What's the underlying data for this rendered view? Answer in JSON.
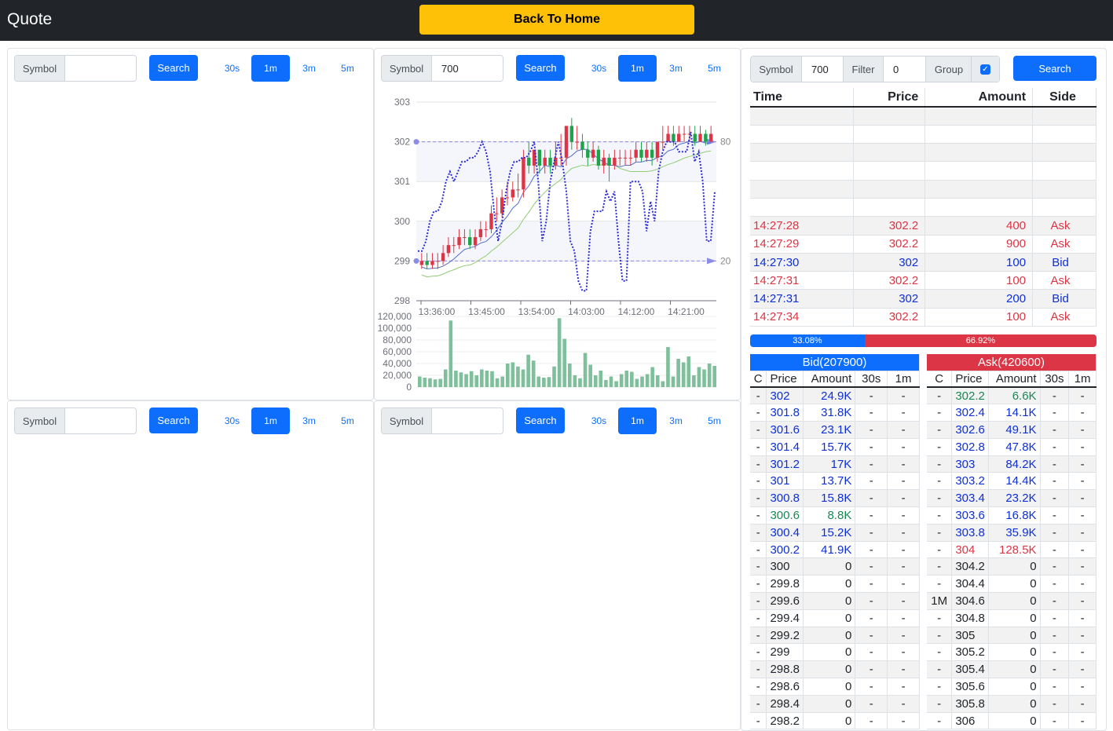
{
  "header": {
    "brand": "Quote",
    "home_button": "Back To Home"
  },
  "panels": [
    {
      "symbol_label": "Symbol",
      "symbol_value": "",
      "search": "Search",
      "intervals": [
        "30s",
        "1m",
        "3m",
        "5m"
      ],
      "active": "1m"
    },
    {
      "symbol_label": "Symbol",
      "symbol_value": "700",
      "search": "Search",
      "intervals": [
        "30s",
        "1m",
        "3m",
        "5m"
      ],
      "active": "1m"
    },
    {
      "symbol_label": "Symbol",
      "symbol_value": "",
      "search": "Search",
      "intervals": [
        "30s",
        "1m",
        "3m",
        "5m"
      ],
      "active": "1m"
    },
    {
      "symbol_label": "Symbol",
      "symbol_value": "",
      "search": "Search",
      "intervals": [
        "30s",
        "1m",
        "3m",
        "5m"
      ],
      "active": "1m"
    }
  ],
  "trade_panel": {
    "symbol_label": "Symbol",
    "symbol_value": "700",
    "filter_label": "Filter",
    "filter_value": "0",
    "group_label": "Group",
    "group_checked": true,
    "search": "Search",
    "columns": [
      "Time",
      "Price",
      "Amount",
      "Side"
    ],
    "rows": [
      {
        "time": "",
        "price": "",
        "amount": "",
        "side": ""
      },
      {
        "time": "",
        "price": "",
        "amount": "",
        "side": ""
      },
      {
        "time": "",
        "price": "",
        "amount": "",
        "side": ""
      },
      {
        "time": "",
        "price": "",
        "amount": "",
        "side": ""
      },
      {
        "time": "",
        "price": "",
        "amount": "",
        "side": ""
      },
      {
        "time": "",
        "price": "",
        "amount": "",
        "side": ""
      },
      {
        "time": "14:27:28",
        "price": "302.2",
        "amount": "400",
        "side": "Ask"
      },
      {
        "time": "14:27:29",
        "price": "302.2",
        "amount": "900",
        "side": "Ask"
      },
      {
        "time": "14:27:30",
        "price": "302",
        "amount": "100",
        "side": "Bid"
      },
      {
        "time": "14:27:31",
        "price": "302.2",
        "amount": "100",
        "side": "Ask"
      },
      {
        "time": "14:27:31",
        "price": "302",
        "amount": "200",
        "side": "Bid"
      },
      {
        "time": "14:27:34",
        "price": "302.2",
        "amount": "100",
        "side": "Ask"
      }
    ],
    "bid_pct": "33.08%",
    "ask_pct": "66.92%",
    "bid_fraction": 0.3308,
    "bid_header": "Bid(207900)",
    "ask_header": "Ask(420600)",
    "book_columns": [
      "C",
      "Price",
      "Amount",
      "30s",
      "1m"
    ],
    "bids": [
      [
        "-",
        "302",
        "24.9K",
        "-",
        "-",
        "blue"
      ],
      [
        "-",
        "301.8",
        "31.8K",
        "-",
        "-",
        "blue"
      ],
      [
        "-",
        "301.6",
        "23.1K",
        "-",
        "-",
        "blue"
      ],
      [
        "-",
        "301.4",
        "15.7K",
        "-",
        "-",
        "blue"
      ],
      [
        "-",
        "301.2",
        "17K",
        "-",
        "-",
        "blue"
      ],
      [
        "-",
        "301",
        "13.7K",
        "-",
        "-",
        "blue"
      ],
      [
        "-",
        "300.8",
        "15.8K",
        "-",
        "-",
        "blue"
      ],
      [
        "-",
        "300.6",
        "8.8K",
        "-",
        "-",
        "green"
      ],
      [
        "-",
        "300.4",
        "15.2K",
        "-",
        "-",
        "blue"
      ],
      [
        "-",
        "300.2",
        "41.9K",
        "-",
        "-",
        "blue"
      ],
      [
        "-",
        "300",
        "0",
        "-",
        "-",
        ""
      ],
      [
        "-",
        "299.8",
        "0",
        "-",
        "-",
        ""
      ],
      [
        "-",
        "299.6",
        "0",
        "-",
        "-",
        ""
      ],
      [
        "-",
        "299.4",
        "0",
        "-",
        "-",
        ""
      ],
      [
        "-",
        "299.2",
        "0",
        "-",
        "-",
        ""
      ],
      [
        "-",
        "299",
        "0",
        "-",
        "-",
        ""
      ],
      [
        "-",
        "298.8",
        "0",
        "-",
        "-",
        ""
      ],
      [
        "-",
        "298.6",
        "0",
        "-",
        "-",
        ""
      ],
      [
        "-",
        "298.4",
        "0",
        "-",
        "-",
        ""
      ],
      [
        "-",
        "298.2",
        "0",
        "-",
        "-",
        ""
      ]
    ],
    "asks": [
      [
        "-",
        "302.2",
        "6.6K",
        "-",
        "-",
        "green"
      ],
      [
        "-",
        "302.4",
        "14.1K",
        "-",
        "-",
        "blue"
      ],
      [
        "-",
        "302.6",
        "49.1K",
        "-",
        "-",
        "blue"
      ],
      [
        "-",
        "302.8",
        "47.8K",
        "-",
        "-",
        "blue"
      ],
      [
        "-",
        "303",
        "84.2K",
        "-",
        "-",
        "blue"
      ],
      [
        "-",
        "303.2",
        "14.4K",
        "-",
        "-",
        "blue"
      ],
      [
        "-",
        "303.4",
        "23.2K",
        "-",
        "-",
        "blue"
      ],
      [
        "-",
        "303.6",
        "16.8K",
        "-",
        "-",
        "blue"
      ],
      [
        "-",
        "303.8",
        "35.9K",
        "-",
        "-",
        "blue"
      ],
      [
        "-",
        "304",
        "128.5K",
        "-",
        "-",
        "red"
      ],
      [
        "-",
        "304.2",
        "0",
        "-",
        "-",
        ""
      ],
      [
        "-",
        "304.4",
        "0",
        "-",
        "-",
        ""
      ],
      [
        "1M",
        "304.6",
        "0",
        "-",
        "-",
        ""
      ],
      [
        "-",
        "304.8",
        "0",
        "-",
        "-",
        ""
      ],
      [
        "-",
        "305",
        "0",
        "-",
        "-",
        ""
      ],
      [
        "-",
        "305.2",
        "0",
        "-",
        "-",
        ""
      ],
      [
        "-",
        "305.4",
        "0",
        "-",
        "-",
        ""
      ],
      [
        "-",
        "305.6",
        "0",
        "-",
        "-",
        ""
      ],
      [
        "-",
        "305.8",
        "0",
        "-",
        "-",
        ""
      ],
      [
        "-",
        "306",
        "0",
        "-",
        "-",
        ""
      ]
    ]
  },
  "colors": {
    "up": "#dc3545",
    "down": "#1fa34a",
    "ma5": "#5470c6",
    "ma10": "#91cc75",
    "kdj": "#2c2cd4",
    "volume": "#7fbf9b"
  },
  "chart_data": {
    "type": "candlestick",
    "price_axis": {
      "ticks": [
        "303",
        "302",
        "301",
        "300",
        "299",
        "298"
      ],
      "ylim": [
        298,
        303
      ]
    },
    "indicator_axis": {
      "ticks": [
        "80",
        "20"
      ],
      "ylim": [
        0,
        100
      ]
    },
    "volume_axis": {
      "ticks": [
        "120,000",
        "100,000",
        "80,000",
        "60,000",
        "40,000",
        "20,000",
        "0"
      ],
      "ylim": [
        0,
        120000
      ]
    },
    "x_ticks": [
      "13:36:00",
      "13:45:00",
      "13:54:00",
      "14:03:00",
      "14:12:00",
      "14:21:00"
    ],
    "candles": [
      [
        298.9,
        299.0,
        299.2,
        298.8
      ],
      [
        299.0,
        298.9,
        299.2,
        298.8
      ],
      [
        298.9,
        299.0,
        299.2,
        298.8
      ],
      [
        299.0,
        299.0,
        299.2,
        298.8
      ],
      [
        299.0,
        299.2,
        299.4,
        298.9
      ],
      [
        299.2,
        299.4,
        299.6,
        299.1
      ],
      [
        299.4,
        299.4,
        299.6,
        299.2
      ],
      [
        299.4,
        299.6,
        299.8,
        299.3
      ],
      [
        299.6,
        299.6,
        299.8,
        299.4
      ],
      [
        299.6,
        299.4,
        299.8,
        299.3
      ],
      [
        299.4,
        299.6,
        299.8,
        299.3
      ],
      [
        299.6,
        299.8,
        300.0,
        299.5
      ],
      [
        299.8,
        299.8,
        300.0,
        299.6
      ],
      [
        299.8,
        300.2,
        300.4,
        299.7
      ],
      [
        300.2,
        300.2,
        300.6,
        300.0
      ],
      [
        300.2,
        300.6,
        300.8,
        300.1
      ],
      [
        300.6,
        300.6,
        301.0,
        300.4
      ],
      [
        300.6,
        300.8,
        301.0,
        300.5
      ],
      [
        300.8,
        300.8,
        301.2,
        300.6
      ],
      [
        300.8,
        301.6,
        301.8,
        300.6
      ],
      [
        301.6,
        301.4,
        302.0,
        301.2
      ],
      [
        301.4,
        301.8,
        301.8,
        301.2
      ],
      [
        301.8,
        301.4,
        301.8,
        301.2
      ],
      [
        301.4,
        301.6,
        301.8,
        301.2
      ],
      [
        301.6,
        301.4,
        301.8,
        301.2
      ],
      [
        301.4,
        301.6,
        302.0,
        301.3
      ],
      [
        301.6,
        301.6,
        302.2,
        301.4
      ],
      [
        301.6,
        302.4,
        302.4,
        301.4
      ],
      [
        302.4,
        302.0,
        302.6,
        301.8
      ],
      [
        302.0,
        302.0,
        302.4,
        301.8
      ],
      [
        302.0,
        301.8,
        302.2,
        301.6
      ],
      [
        301.8,
        301.6,
        302.0,
        301.4
      ],
      [
        301.6,
        301.8,
        302.0,
        301.5
      ],
      [
        301.8,
        301.4,
        301.9,
        301.3
      ],
      [
        301.4,
        301.6,
        301.8,
        301.2
      ],
      [
        301.6,
        301.4,
        301.7,
        301.0
      ],
      [
        301.4,
        301.6,
        301.8,
        301.3
      ],
      [
        301.6,
        301.6,
        301.8,
        301.4
      ],
      [
        301.6,
        301.6,
        301.8,
        301.4
      ],
      [
        301.6,
        301.6,
        301.8,
        301.4
      ],
      [
        301.6,
        301.8,
        302.0,
        301.5
      ],
      [
        301.8,
        301.6,
        302.0,
        301.5
      ],
      [
        301.6,
        301.8,
        302.0,
        301.5
      ],
      [
        301.8,
        301.6,
        302.0,
        301.4
      ],
      [
        301.6,
        302.0,
        302.0,
        301.5
      ],
      [
        302.0,
        302.0,
        302.4,
        301.8
      ],
      [
        302.0,
        302.2,
        302.4,
        302.0
      ],
      [
        302.2,
        302.0,
        302.4,
        301.9
      ],
      [
        302.0,
        302.2,
        302.4,
        302.0
      ],
      [
        302.2,
        302.2,
        302.4,
        302.0
      ],
      [
        302.2,
        302.2,
        302.4,
        302.0
      ],
      [
        302.2,
        302.0,
        302.4,
        301.9
      ],
      [
        302.0,
        302.2,
        302.4,
        302.0
      ],
      [
        302.2,
        302.0,
        302.3,
        301.9
      ],
      [
        302.0,
        302.2,
        302.4,
        302.0
      ]
    ],
    "kdj": [
      25,
      25,
      30,
      40,
      45,
      45,
      50,
      60,
      65,
      60,
      65,
      70,
      70,
      72,
      72,
      75,
      80,
      75,
      65,
      45,
      30,
      40,
      55,
      65,
      70,
      70,
      72,
      72,
      75,
      80,
      60,
      30,
      40,
      60,
      70,
      80,
      70,
      55,
      30,
      25,
      10,
      5,
      5,
      35,
      45,
      45,
      45,
      55,
      50,
      55,
      30,
      10,
      10,
      60,
      60,
      60,
      55,
      35,
      50,
      40,
      65,
      75,
      80,
      80,
      80,
      75,
      75,
      75,
      85,
      70,
      75,
      60,
      30,
      30,
      55
    ],
    "volume": [
      18000,
      16000,
      15000,
      13000,
      14000,
      30000,
      113000,
      28000,
      25000,
      22000,
      27000,
      20000,
      30000,
      28000,
      27000,
      15000,
      18000,
      40000,
      42000,
      35000,
      30000,
      55000,
      45000,
      18000,
      16000,
      17000,
      35000,
      117000,
      82000,
      40000,
      20000,
      15000,
      58000,
      38000,
      20000,
      28000,
      12000,
      18000,
      10000,
      22000,
      28000,
      26000,
      14000,
      18000,
      22000,
      34000,
      20000,
      10000,
      68000,
      18000,
      48000,
      42000,
      52000,
      20000,
      34000,
      30000,
      40000,
      36000
    ]
  }
}
